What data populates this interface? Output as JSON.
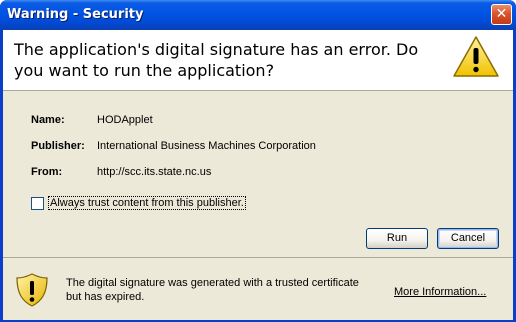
{
  "window": {
    "title": "Warning - Security",
    "close_label": "✕"
  },
  "header": {
    "message": "The application's digital signature has an error.  Do you want to run the application?",
    "icon": "warning-triangle-icon"
  },
  "fields": {
    "name_label": "Name:",
    "name_value": "HODApplet",
    "publisher_label": "Publisher:",
    "publisher_value": "International Business Machines Corporation",
    "from_label": "From:",
    "from_value": "http://scc.its.state.nc.us"
  },
  "trust_checkbox": {
    "label": "Always trust content from this publisher.",
    "checked": false
  },
  "buttons": {
    "run": "Run",
    "cancel": "Cancel"
  },
  "footer": {
    "icon": "shield-warning-icon",
    "message": "The digital signature was generated with a trusted certificate but has expired.",
    "more_info": "More Information..."
  },
  "colors": {
    "titlebar": "#0054e3",
    "dialog_bg": "#ece9d8",
    "warning_yellow": "#f8d030"
  }
}
